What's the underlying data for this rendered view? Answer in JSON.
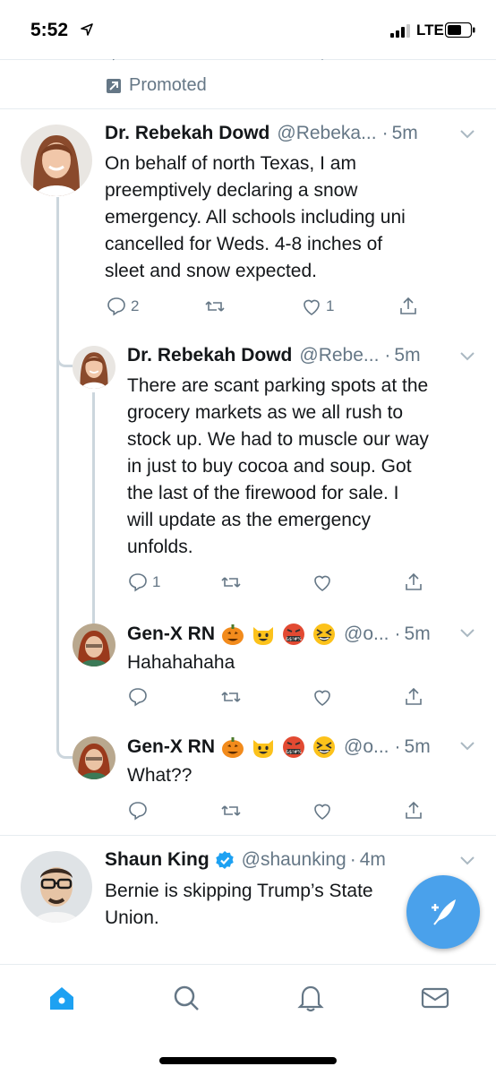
{
  "status_bar": {
    "time": "5:52",
    "network": "LTE"
  },
  "promoted": {
    "label": "Promoted"
  },
  "tweets": [
    {
      "name": "Dr. Rebekah Dowd",
      "handle": "@Rebeka...",
      "time": "5m",
      "text": "On behalf of north Texas, I am\npreemptively declaring a snow\nemergency. All schools including uni\ncancelled for Weds. 4-8 inches of\nsleet and snow expected.",
      "replies": "2",
      "retweets": "",
      "likes": "1"
    },
    {
      "name": "Dr. Rebekah Dowd",
      "handle": "@Rebe...",
      "time": "5m",
      "text": "There are scant parking spots at the\ngrocery markets as we all rush to\nstock up. We had to muscle our way\nin just to buy cocoa and soup. Got\nthe last of the firewood for sale. I\nwill update as the emergency\nunfolds.",
      "replies": "1",
      "retweets": "",
      "likes": ""
    },
    {
      "name": "Gen-X RN",
      "handle": "@o...",
      "time": "5m",
      "text": "Hahahahaha",
      "emoji": [
        "jack-o-lantern",
        "grinning-cat",
        "cursing-face",
        "grinning-squinting-face"
      ]
    },
    {
      "name": "Gen-X RN",
      "handle": "@o...",
      "time": "5m",
      "text": "What??",
      "emoji": [
        "jack-o-lantern",
        "grinning-cat",
        "cursing-face",
        "grinning-squinting-face"
      ]
    },
    {
      "name": "Shaun King",
      "handle": "@shaunking",
      "time": "4m",
      "verified": true,
      "text": "Bernie is skipping Trump’s State\nUnion."
    }
  ],
  "colors": {
    "accent": "#1da1f2",
    "fab": "#4aa1eb",
    "muted": "#657786",
    "text": "#14171a",
    "divider": "#e6ecf0"
  },
  "tabs": [
    "home-icon",
    "search-icon",
    "notifications-icon",
    "messages-icon"
  ]
}
